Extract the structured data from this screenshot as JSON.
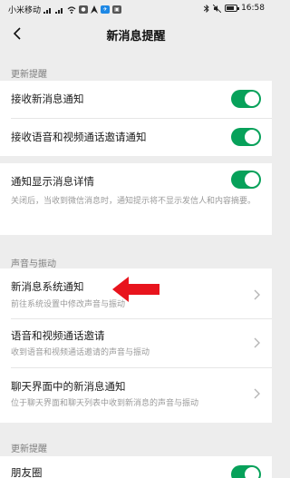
{
  "status_bar": {
    "carrier": "小米移动",
    "time": "16:58"
  },
  "nav": {
    "title": "新消息提醒"
  },
  "sections": {
    "s1": "更新提醒",
    "s2": "声音与振动",
    "s3": "更新提醒"
  },
  "rows": {
    "receive_new": {
      "label": "接收新消息通知",
      "on": true
    },
    "receive_voice_video": {
      "label": "接收语音和视频通话邀请通知",
      "on": true
    },
    "show_details": {
      "label": "通知显示消息详情",
      "on": true,
      "desc": "关闭后，当收到微信消息时，通知提示将不显示发信人和内容摘要。"
    },
    "system_notify": {
      "label": "新消息系统通知",
      "desc": "前往系统设置中修改声音与振动"
    },
    "call_invite": {
      "label": "语音和视频通话邀请",
      "desc": "收到语音和视频通话邀请的声音与振动"
    },
    "chat_notify": {
      "label": "聊天界面中的新消息通知",
      "desc": "位于聊天界面和聊天列表中收到新消息的声音与振动"
    },
    "moments": {
      "label": "朋友圈",
      "on": true
    }
  },
  "colors": {
    "toggle_on": "#07a15a",
    "annotation_arrow": "#e8141d"
  }
}
